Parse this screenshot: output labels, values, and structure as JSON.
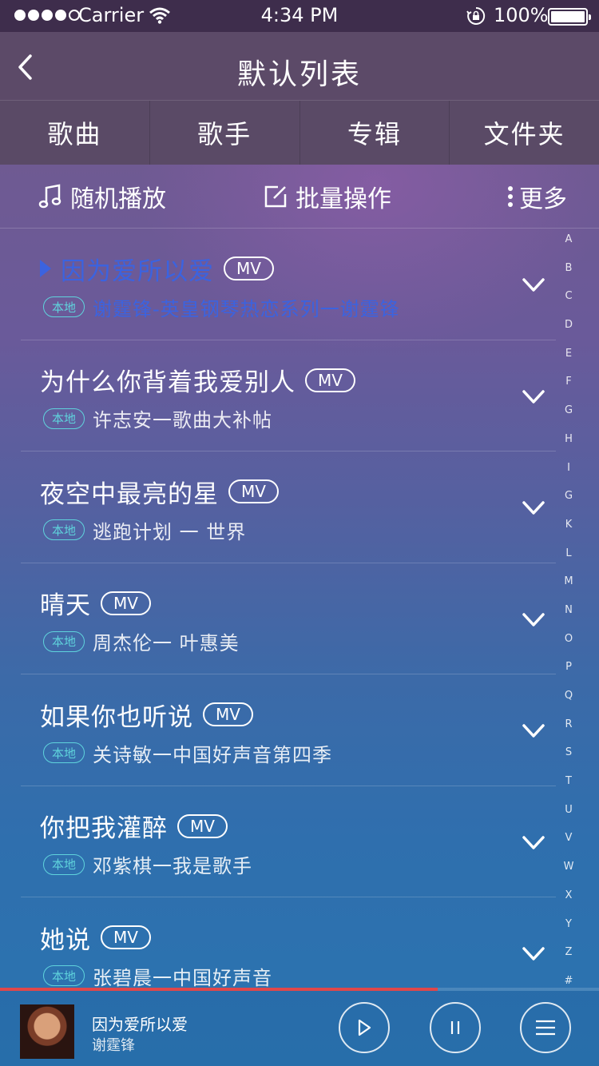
{
  "status_bar": {
    "carrier": "Carrier",
    "time": "4:34 PM",
    "battery": "100%"
  },
  "nav": {
    "title": "默认列表"
  },
  "tabs": [
    "歌曲",
    "歌手",
    "专辑",
    "文件夹"
  ],
  "toolbar": {
    "shuffle": "随机播放",
    "batch": "批量操作",
    "more": "更多"
  },
  "badges": {
    "mv": "MV",
    "local": "本地"
  },
  "songs": [
    {
      "name": "因为爱所以爱",
      "artist": "谢霆锋-英皇钢琴热恋系列一谢霆锋",
      "playing": true
    },
    {
      "name": "为什么你背着我爱别人",
      "artist": "许志安一歌曲大补帖",
      "playing": false
    },
    {
      "name": "夜空中最亮的星",
      "artist": "逃跑计划 一 世界",
      "playing": false
    },
    {
      "name": "晴天",
      "artist": "周杰伦一 叶惠美",
      "playing": false
    },
    {
      "name": "如果你也听说",
      "artist": "关诗敏一中国好声音第四季",
      "playing": false
    },
    {
      "name": "你把我灌醉",
      "artist": "邓紫棋一我是歌手",
      "playing": false
    },
    {
      "name": "她说",
      "artist": "张碧晨一中国好声音",
      "playing": false
    }
  ],
  "index_letters": [
    "A",
    "B",
    "C",
    "D",
    "E",
    "F",
    "G",
    "H",
    "I",
    "G",
    "K",
    "L",
    "M",
    "N",
    "O",
    "P",
    "Q",
    "R",
    "S",
    "T",
    "U",
    "V",
    "W",
    "X",
    "Y",
    "Z",
    "#"
  ],
  "player": {
    "title": "因为爱所以爱",
    "artist": "谢霆锋",
    "progress": 0.73
  },
  "colors": {
    "accent_playing": "#3b63e0",
    "local_badge": "#5fd3dc",
    "progress": "#e0474a"
  }
}
